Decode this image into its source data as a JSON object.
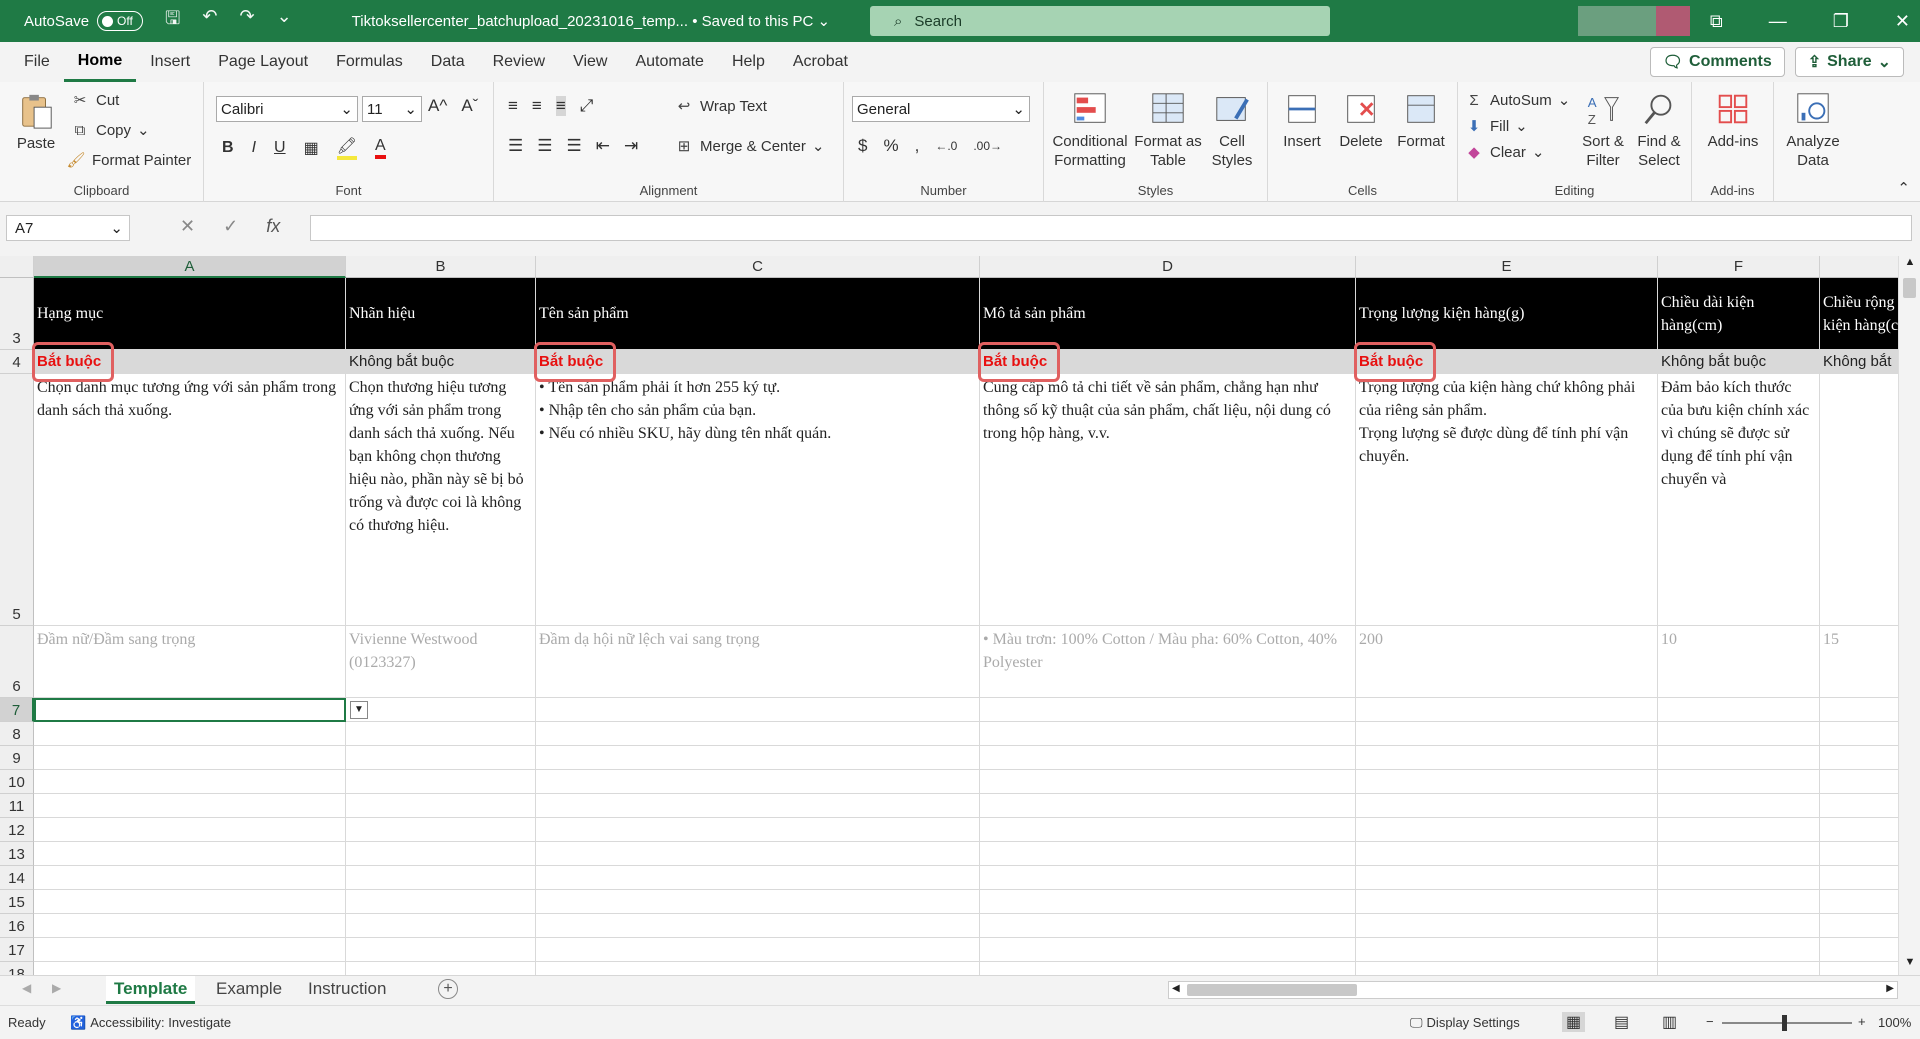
{
  "titlebar": {
    "autosave_label": "AutoSave",
    "autosave_state": "Off",
    "filename": "Tiktoksellercenter_batchupload_20231016_temp...",
    "saved_status": "• Saved to this PC",
    "search_placeholder": "Search"
  },
  "menu": {
    "tabs": [
      "File",
      "Home",
      "Insert",
      "Page Layout",
      "Formulas",
      "Data",
      "Review",
      "View",
      "Automate",
      "Help",
      "Acrobat"
    ],
    "active": "Home",
    "comments_label": "Comments",
    "share_label": "Share"
  },
  "ribbon": {
    "clipboard": {
      "paste": "Paste",
      "cut": "Cut",
      "copy": "Copy",
      "format_painter": "Format Painter",
      "label": "Clipboard"
    },
    "font": {
      "name": "Calibri",
      "size": "11",
      "label": "Font"
    },
    "alignment": {
      "wrap_text": "Wrap Text",
      "merge_center": "Merge & Center",
      "label": "Alignment"
    },
    "number": {
      "format": "General",
      "label": "Number"
    },
    "styles": {
      "conditional": "Conditional Formatting",
      "format_table": "Format as Table",
      "cell_styles": "Cell Styles",
      "label": "Styles"
    },
    "cells": {
      "insert": "Insert",
      "delete": "Delete",
      "format": "Format",
      "label": "Cells"
    },
    "editing": {
      "autosum": "AutoSum",
      "fill": "Fill",
      "clear": "Clear",
      "sort_filter": "Sort & Filter",
      "find_select": "Find & Select",
      "label": "Editing"
    },
    "addins": {
      "addins": "Add-ins",
      "label": "Add-ins"
    },
    "analyze": {
      "label": "Analyze Data"
    }
  },
  "formula_bar": {
    "name_box": "A7",
    "fx": "fx",
    "formula": ""
  },
  "columns": [
    "A",
    "B",
    "C",
    "D",
    "E",
    "F"
  ],
  "rows": [
    "3",
    "4",
    "5",
    "6",
    "7",
    "8",
    "9",
    "10",
    "11",
    "12",
    "13",
    "14",
    "15",
    "16",
    "17",
    "18"
  ],
  "sheet": {
    "headers": [
      "Hạng mục",
      "Nhãn hiệu",
      "Tên sản phẩm",
      "Mô tả sản phẩm",
      "Trọng lượng kiện hàng(g)",
      "Chiều dài kiện hàng(cm)",
      "Chiều rộng kiện hàng(cm)"
    ],
    "required": [
      "Bắt buộc",
      "Không bắt buộc",
      "Bắt buộc",
      "Bắt buộc",
      "Bắt buộc",
      "Không bắt buộc",
      "Không bắt buộc"
    ],
    "descriptions": [
      "Chọn danh mục tương ứng với sản phẩm trong danh sách thả xuống.",
      "Chọn thương hiệu tương ứng với sản phẩm trong danh sách thả xuống. Nếu bạn không chọn thương hiệu nào, phần này sẽ bị bỏ trống và được coi là không có thương hiệu.",
      "• Tên sản phẩm phải ít hơn 255 ký tự.\n• Nhập tên cho sản phẩm của bạn.\n• Nếu có nhiều SKU, hãy dùng tên nhất quán.",
      "Cung cấp mô tả chi tiết về sản phẩm, chẳng hạn như thông số kỹ thuật của sản phẩm, chất liệu, nội dung có trong hộp hàng, v.v.",
      "Trọng lượng của kiện hàng chứ không phải của riêng sản phẩm.\nTrọng lượng sẽ được dùng để tính phí vận chuyển.",
      "Đảm bảo kích thước của bưu kiện chính xác vì chúng sẽ được sử dụng để tính phí vận chuyển và",
      ""
    ],
    "examples": [
      "Đầm nữ/Đầm sang trọng",
      "Vivienne Westwood (0123327)",
      "Đầm dạ hội nữ lệch vai sang trọng",
      "• Màu trơn: 100% Cotton / Màu pha: 60% Cotton, 40% Polyester",
      "200",
      "10",
      "15"
    ]
  },
  "sheet_tabs": [
    "Template",
    "Example",
    "Instruction"
  ],
  "status": {
    "ready": "Ready",
    "accessibility": "Accessibility: Investigate",
    "display_settings": "Display Settings",
    "zoom": "100%"
  },
  "colors": {
    "accent": "#1f7a45",
    "required": "#e81010",
    "header_bg": "#000000"
  }
}
